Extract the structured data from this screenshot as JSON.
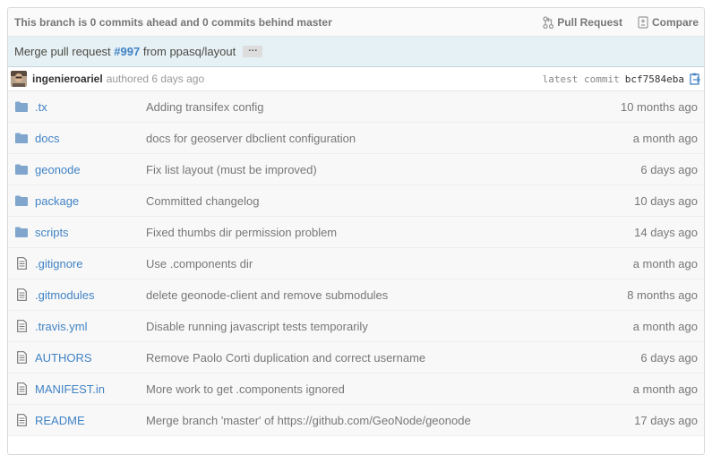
{
  "branch_bar": {
    "status": "This branch is 0 commits ahead and 0 commits behind master",
    "pull_request_label": "Pull Request",
    "compare_label": "Compare"
  },
  "commit": {
    "title_prefix": "Merge pull request",
    "pr_number": "#997",
    "title_suffix": "from ppasq/layout",
    "ellipsis": "…",
    "author": "ingenieroariel",
    "authored_text": "authored 6 days ago",
    "latest_commit_label": "latest commit",
    "sha": "bcf7584eba"
  },
  "files": [
    {
      "type": "dir",
      "icon": "folder-icon",
      "name": ".tx",
      "message": "Adding transifex config",
      "age": "10 months ago"
    },
    {
      "type": "dir",
      "icon": "folder-icon",
      "name": "docs",
      "message": "docs for geoserver dbclient configuration",
      "age": "a month ago"
    },
    {
      "type": "dir",
      "icon": "folder-icon",
      "name": "geonode",
      "message": "Fix list layout (must be improved)",
      "age": "6 days ago"
    },
    {
      "type": "dir",
      "icon": "folder-icon",
      "name": "package",
      "message": "Committed changelog",
      "age": "10 days ago"
    },
    {
      "type": "dir",
      "icon": "folder-icon",
      "name": "scripts",
      "message": "Fixed thumbs dir permission problem",
      "age": "14 days ago"
    },
    {
      "type": "file",
      "icon": "file-icon",
      "name": ".gitignore",
      "message": "Use .components dir",
      "age": "a month ago"
    },
    {
      "type": "file",
      "icon": "file-icon",
      "name": ".gitmodules",
      "message": "delete geonode-client and remove submodules",
      "age": "8 months ago"
    },
    {
      "type": "file",
      "icon": "file-icon",
      "name": ".travis.yml",
      "message": "Disable running javascript tests temporarily",
      "age": "a month ago"
    },
    {
      "type": "file",
      "icon": "file-icon",
      "name": "AUTHORS",
      "message": "Remove Paolo Corti duplication and correct username",
      "age": "6 days ago"
    },
    {
      "type": "file",
      "icon": "file-icon",
      "name": "MANIFEST.in",
      "message": "More work to get .components ignored",
      "age": "a month ago"
    },
    {
      "type": "file",
      "icon": "file-icon",
      "name": "README",
      "message": "Merge branch 'master' of https://github.com/GeoNode/geonode",
      "age": "17 days ago"
    }
  ],
  "colors": {
    "link": "#4183c4",
    "folder": "#80a6cd",
    "muted": "#777777",
    "commit_bg": "#e6f1f6"
  }
}
